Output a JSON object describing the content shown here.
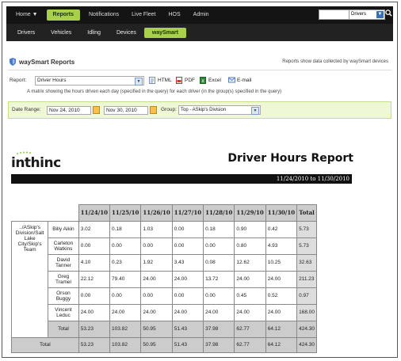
{
  "nav": {
    "items": [
      {
        "label": "Home ▼",
        "active": false
      },
      {
        "label": "Reports",
        "active": true
      },
      {
        "label": "Notifications",
        "active": false
      },
      {
        "label": "Live Fleet",
        "active": false
      },
      {
        "label": "HOS",
        "active": false
      },
      {
        "label": "Admin",
        "active": false
      }
    ],
    "search_value": "",
    "search_scope": "Drivers"
  },
  "subnav": {
    "items": [
      {
        "label": "Drivers",
        "active": false
      },
      {
        "label": "Vehicles",
        "active": false
      },
      {
        "label": "Idling",
        "active": false
      },
      {
        "label": "Devices",
        "active": false
      },
      {
        "label": "waySmart",
        "active": true
      }
    ]
  },
  "panel": {
    "title": "waySmart Reports",
    "note": "Reports show data collected by waySmart devices",
    "report_label": "Report:",
    "report_value": "Driver Hours",
    "exports": [
      "HTML",
      "PDF",
      "Excel",
      "E-mail"
    ],
    "description": "A matrix showing the hours driven each day (specified in the query) for each driver (in the group(s) specified in the query)",
    "date_label": "Date Range:",
    "date_from": "Nov 24, 2010",
    "date_to": "Nov 30, 2010",
    "group_label": "Group:",
    "group_value": "Top - ASkip's Division"
  },
  "report": {
    "logo": "inthinc",
    "title": "Driver Hours Report",
    "range": "11/24/2010 to 11/30/2010",
    "columns": [
      "11/24/10",
      "11/25/10",
      "11/26/10",
      "11/27/10",
      "11/28/10",
      "11/29/10",
      "11/30/10",
      "Total"
    ],
    "group": "../ASkip's Division/Salt Lake City/Skip's Team",
    "rows": [
      {
        "name": "Billy Aikin",
        "values": [
          "3.02",
          "0.18",
          "1.03",
          "0.00",
          "0.18",
          "0.90",
          "0.42",
          "5.73"
        ]
      },
      {
        "name": "Carleton Watkins",
        "values": [
          "0.00",
          "0.00",
          "0.00",
          "0.00",
          "0.00",
          "0.80",
          "4.93",
          "5.73"
        ]
      },
      {
        "name": "David Tanner",
        "values": [
          "4.10",
          "0.23",
          "1.92",
          "3.43",
          "0.08",
          "12.62",
          "10.25",
          "32.63"
        ]
      },
      {
        "name": "Greg Tramel",
        "values": [
          "22.12",
          "79.40",
          "24.00",
          "24.00",
          "13.72",
          "24.00",
          "24.00",
          "211.23"
        ]
      },
      {
        "name": "Orson Buggy",
        "values": [
          "0.00",
          "0.00",
          "0.00",
          "0.00",
          "0.00",
          "0.45",
          "0.52",
          "0.97"
        ]
      },
      {
        "name": "Vincent Leduc",
        "values": [
          "24.00",
          "24.00",
          "24.00",
          "24.00",
          "24.00",
          "24.00",
          "24.00",
          "168.00"
        ]
      }
    ],
    "subtotal_label": "Total",
    "subtotal": [
      "53.23",
      "103.82",
      "50.95",
      "51.43",
      "37.98",
      "62.77",
      "64.12",
      "424.30"
    ],
    "grand_label": "Total",
    "grand": [
      "53.23",
      "103.82",
      "50.95",
      "51.43",
      "37.98",
      "62.77",
      "64.12",
      "424.30"
    ]
  }
}
